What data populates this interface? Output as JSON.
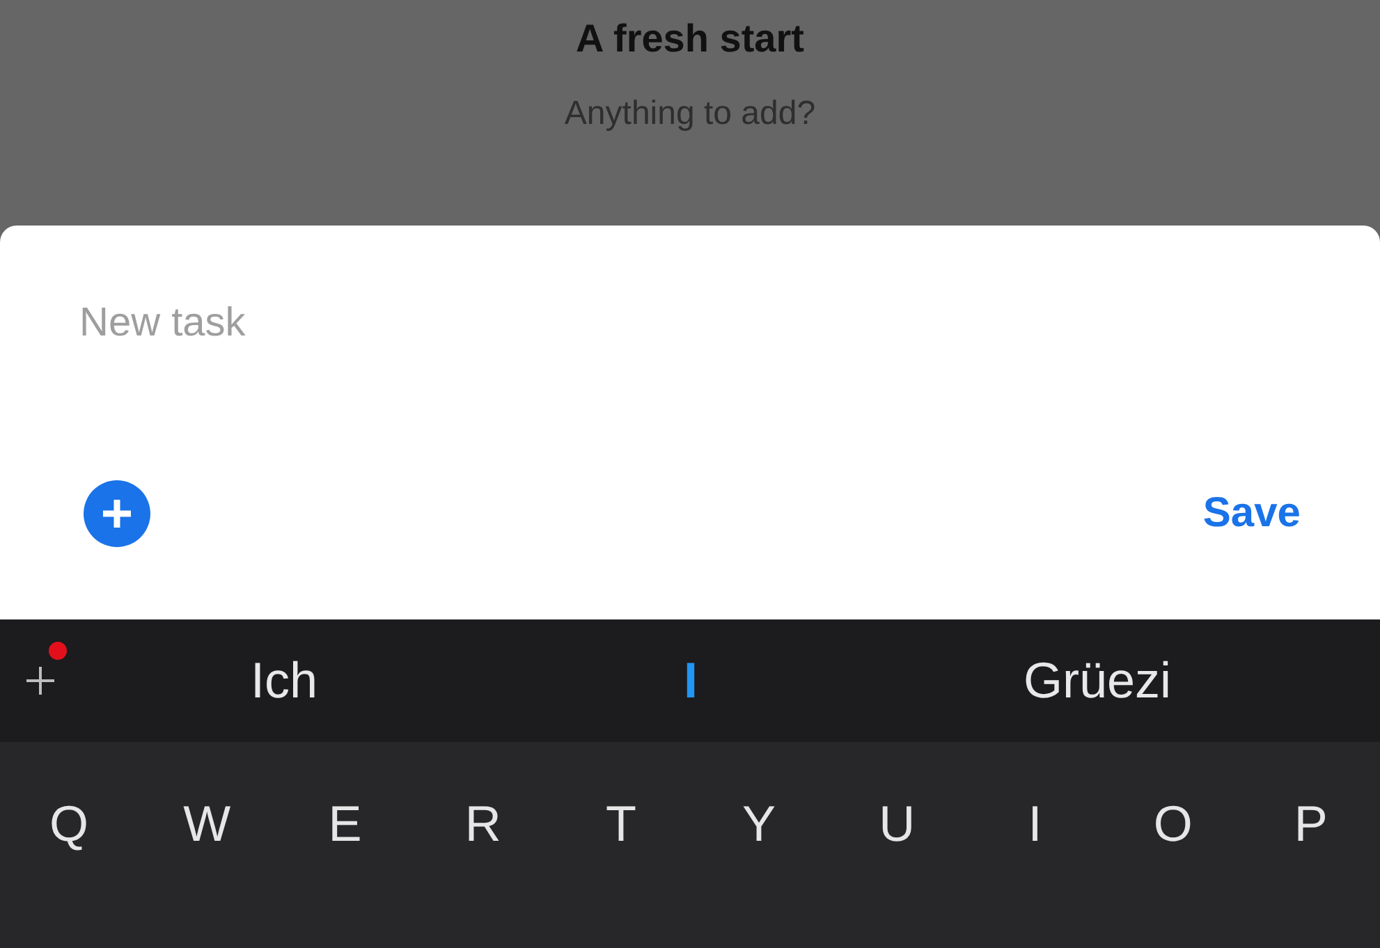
{
  "background": {
    "title": "A fresh start",
    "subtitle": "Anything to add?"
  },
  "sheet": {
    "task_field": {
      "placeholder": "New task"
    },
    "save_button": "Save"
  },
  "keyboard": {
    "suggestions": [
      {
        "text": "Ich",
        "selected": false
      },
      {
        "text": "I",
        "selected": true
      },
      {
        "text": "Grüezi",
        "selected": false
      }
    ],
    "addon_badge": true,
    "keys": [
      "Q",
      "W",
      "E",
      "R",
      "T",
      "Y",
      "U",
      "I",
      "O",
      "P"
    ]
  }
}
